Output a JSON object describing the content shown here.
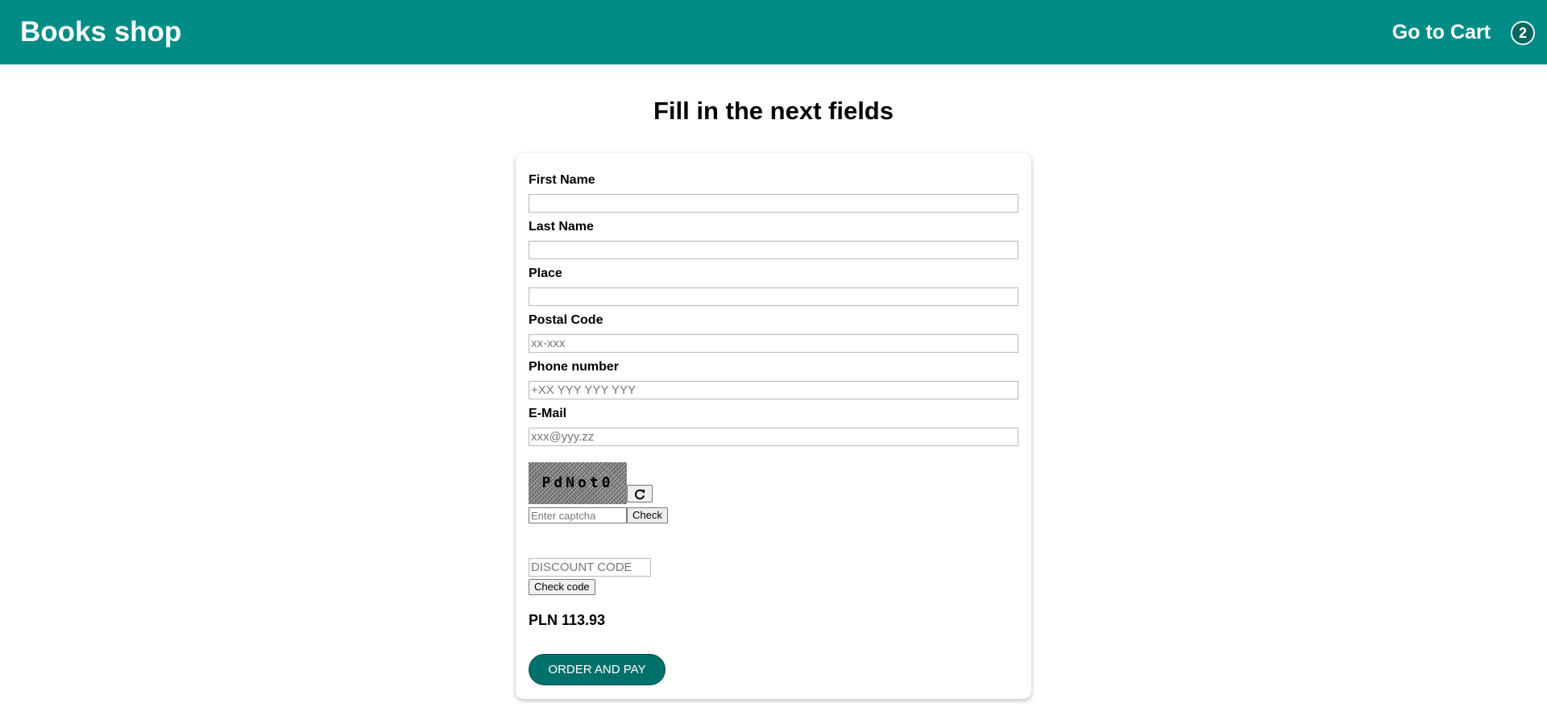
{
  "header": {
    "brand": "Books shop",
    "cart_link": "Go to Cart",
    "cart_count": "2",
    "color": "#008c86"
  },
  "page_title": "Fill in the next fields",
  "form": {
    "first_name": {
      "label": "First Name",
      "value": "",
      "placeholder": ""
    },
    "last_name": {
      "label": "Last Name",
      "value": "",
      "placeholder": ""
    },
    "place": {
      "label": "Place",
      "value": "",
      "placeholder": ""
    },
    "postal_code": {
      "label": "Postal Code",
      "value": "",
      "placeholder": "xx-xxx"
    },
    "phone": {
      "label": "Phone number",
      "value": "",
      "placeholder": "+XX YYY YYY YYY"
    },
    "email": {
      "label": "E-Mail",
      "value": "",
      "placeholder": "xxx@yyy.zz"
    }
  },
  "captcha": {
    "code": "PdNot0",
    "refresh_icon": "refresh-icon",
    "input_placeholder": "Enter captcha",
    "check_label": "Check"
  },
  "discount": {
    "placeholder": "DISCOUNT CODE",
    "check_label": "Check code"
  },
  "total": "PLN 113.93",
  "order_button": {
    "label": "ORDER AND PAY",
    "color": "#00706a"
  }
}
